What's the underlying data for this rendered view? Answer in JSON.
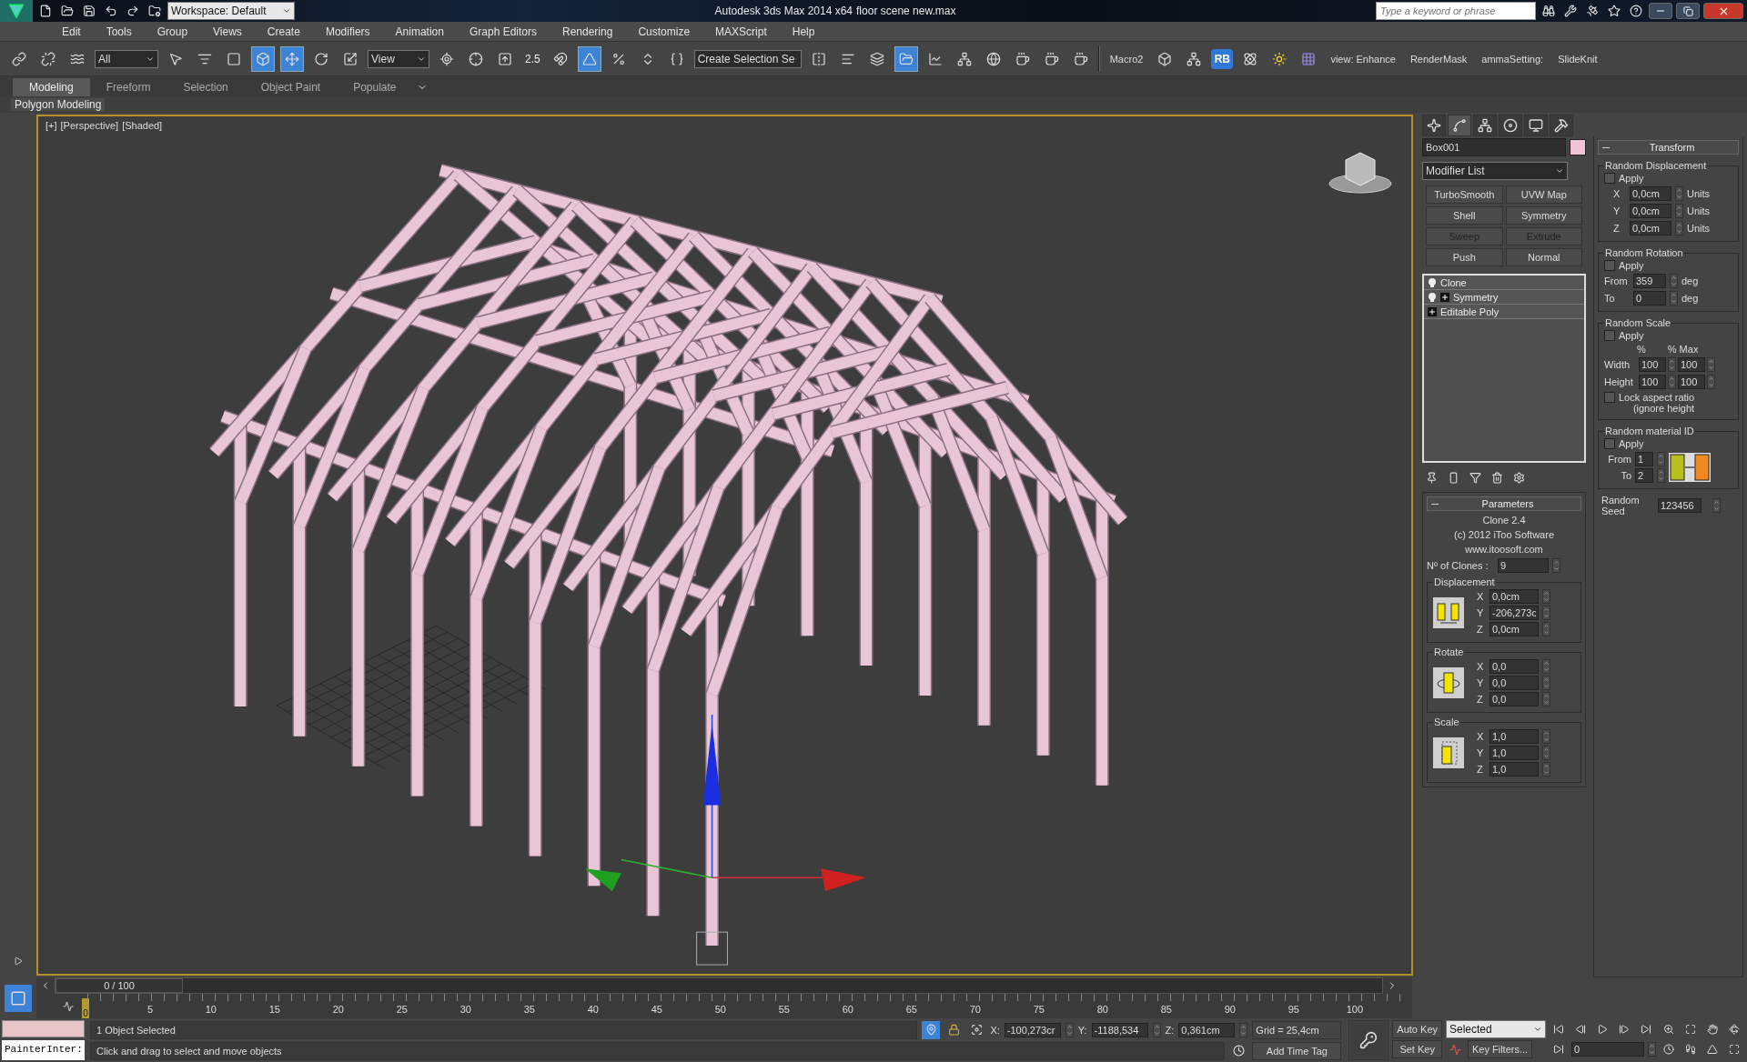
{
  "title_bar": {
    "workspace": "Workspace: Default",
    "app_title": "Autodesk 3ds Max  2014 x64",
    "file_name": "floor scene new.max",
    "search_placeholder": "Type a keyword or phrase"
  },
  "menu": [
    "Edit",
    "Tools",
    "Group",
    "Views",
    "Create",
    "Modifiers",
    "Animation",
    "Graph Editors",
    "Rendering",
    "Customize",
    "MAXScript",
    "Help"
  ],
  "main_toolbar": {
    "selection_filter": "All",
    "reference_coordinate": "View",
    "snap_value": "2.5",
    "named_selection": "Create Selection Se",
    "macro": "Macro2",
    "badge": "RB",
    "macros": [
      "view: Enhance",
      "RenderMask",
      "ammaSetting:",
      "SlideKnit"
    ]
  },
  "ribbon": {
    "tabs": [
      {
        "label": "Modeling",
        "selected": true
      },
      {
        "label": "Freeform",
        "selected": false
      },
      {
        "label": "Selection",
        "selected": false
      },
      {
        "label": "Object Paint",
        "selected": false
      },
      {
        "label": "Populate",
        "selected": false
      }
    ],
    "panel": "Polygon Modeling"
  },
  "viewport": {
    "labels": [
      "[+]",
      "[Perspective]",
      "[Shaded]"
    ]
  },
  "command_panel": {
    "tabs": [
      {
        "kind": "create",
        "selected": false
      },
      {
        "kind": "modify",
        "selected": true
      },
      {
        "kind": "hierarchy",
        "selected": false
      },
      {
        "kind": "motion",
        "selected": false
      },
      {
        "kind": "display",
        "selected": false
      },
      {
        "kind": "utilities",
        "selected": false
      }
    ],
    "object_name": "Box001",
    "modifier_list": "Modifier List",
    "modifier_buttons": [
      {
        "label": "TurboSmooth",
        "disabled": false
      },
      {
        "label": "UVW Map",
        "disabled": false
      },
      {
        "label": "Shell",
        "disabled": false
      },
      {
        "label": "Symmetry",
        "disabled": false
      },
      {
        "label": "Sweep",
        "disabled": true
      },
      {
        "label": "Extrude",
        "disabled": true
      },
      {
        "label": "Push",
        "disabled": false
      },
      {
        "label": "Normal",
        "disabled": false
      }
    ],
    "stack": [
      {
        "label": "Clone",
        "bulb": true,
        "expandable": false
      },
      {
        "label": "Symmetry",
        "bulb": true,
        "expandable": true
      },
      {
        "label": "Editable Poly",
        "bulb": false,
        "expandable": true
      }
    ]
  },
  "parameters": {
    "title": "Parameters",
    "about": [
      "Clone 2.4",
      "(c) 2012 iToo Software",
      "www.itoosoft.com"
    ],
    "clones_label": "Nº of Clones :",
    "clones_value": "9",
    "groups": [
      {
        "kind": "displacement",
        "title": "Displacement",
        "fields": [
          {
            "axis": "X",
            "value": "0,0cm"
          },
          {
            "axis": "Y",
            "value": "-206,273c"
          },
          {
            "axis": "Z",
            "value": "0,0cm"
          }
        ]
      },
      {
        "kind": "rotate",
        "title": "Rotate",
        "fields": [
          {
            "axis": "X",
            "value": "0,0"
          },
          {
            "axis": "Y",
            "value": "0,0"
          },
          {
            "axis": "Z",
            "value": "0,0"
          }
        ]
      },
      {
        "kind": "scale",
        "title": "Scale",
        "fields": [
          {
            "axis": "X",
            "value": "1,0"
          },
          {
            "axis": "Y",
            "value": "1,0"
          },
          {
            "axis": "Z",
            "value": "1,0"
          }
        ]
      }
    ]
  },
  "transform": {
    "title": "Transform",
    "random_displacement": {
      "title": "Random Displacement",
      "apply": {
        "label": "Apply",
        "checked": false
      },
      "fields": [
        {
          "axis": "X",
          "value": "0,0cm",
          "unit": "Units"
        },
        {
          "axis": "Y",
          "value": "0,0cm",
          "unit": "Units"
        },
        {
          "axis": "Z",
          "value": "0,0cm",
          "unit": "Units"
        }
      ]
    },
    "random_rotation": {
      "title": "Random Rotation",
      "apply": {
        "label": "Apply",
        "checked": false
      },
      "fields": [
        {
          "label": "From",
          "value": "359",
          "unit": "deg"
        },
        {
          "label": "To",
          "value": "0",
          "unit": "deg"
        }
      ]
    },
    "random_scale": {
      "title": "Random Scale",
      "apply": {
        "label": "Apply",
        "checked": false
      },
      "headers": [
        "%",
        "% Max"
      ],
      "rows": [
        {
          "label": "Width",
          "values": [
            "100",
            "100"
          ]
        },
        {
          "label": "Height",
          "values": [
            "100",
            "100"
          ]
        }
      ],
      "lock": {
        "label": "Lock aspect ratio",
        "note": "(ignore height",
        "checked": false
      }
    },
    "random_material": {
      "title": "Random material ID",
      "apply": {
        "label": "Apply",
        "checked": false
      },
      "fields": [
        {
          "label": "From",
          "value": "1"
        },
        {
          "label": "To",
          "value": "2"
        }
      ]
    },
    "seed": {
      "label": "Random Seed",
      "value": "123456"
    }
  },
  "timeline": {
    "position": "0 / 100",
    "current_frame": "0",
    "ticks": [
      "5",
      "10",
      "15",
      "20",
      "25",
      "30",
      "35",
      "40",
      "45",
      "50",
      "55",
      "60",
      "65",
      "70",
      "75",
      "80",
      "85",
      "90",
      "95",
      "100"
    ]
  },
  "status_bar": {
    "listener": "PainterInter:",
    "selection": "1 Object Selected",
    "prompt": "Click and drag to select and move objects",
    "coordinates": [
      {
        "label": "X:",
        "value": "-100,273cr"
      },
      {
        "label": "Y:",
        "value": "-1188,534"
      },
      {
        "label": "Z:",
        "value": "0,361cm"
      }
    ],
    "grid": "Grid = 25,4cm",
    "time_tag": "Add Time Tag",
    "auto_key": "Auto Key",
    "set_key": "Set Key",
    "key_mode": "Selected",
    "key_filters": "Key Filters...",
    "frame": "0"
  }
}
